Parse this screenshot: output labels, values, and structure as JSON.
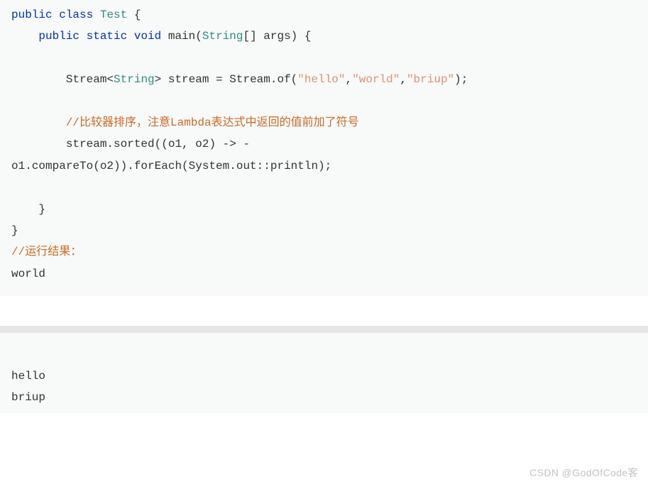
{
  "code": {
    "line1": {
      "kw1": "public",
      "kw2": "class",
      "cls": "Test",
      "rest": " {"
    },
    "line2": {
      "indent": "    ",
      "kw1": "public",
      "kw2": "static",
      "kw3": "void",
      "fn": " main(",
      "type": "String",
      "rest": "[] args) {"
    },
    "line3": "",
    "line4": {
      "indent": "        ",
      "p1": "Stream<",
      "type": "String",
      "p2": "> stream = Stream.of(",
      "s1": "\"hello\"",
      "c1": ",",
      "s2": "\"world\"",
      "c2": ",",
      "s3": "\"briup\"",
      "rest": ");"
    },
    "line5": "",
    "line6": {
      "indent": "        ",
      "comment": "//比较器排序，注意Lambda表达式中返回的值前加了符号"
    },
    "line7": {
      "indent": "        ",
      "text": "stream.sorted((o1, o2) -> -"
    },
    "line8": {
      "text": "o1.compareTo(o2)).forEach(System.out::println);"
    },
    "line9": "",
    "line10": {
      "indent": "    ",
      "text": "}"
    },
    "line11": {
      "text": "}"
    },
    "line12": {
      "comment": "//运行结果："
    },
    "line13": {
      "text": "world"
    }
  },
  "output": {
    "line1": "hello",
    "line2": "briup"
  },
  "watermark": "CSDN @GodOfCode客"
}
